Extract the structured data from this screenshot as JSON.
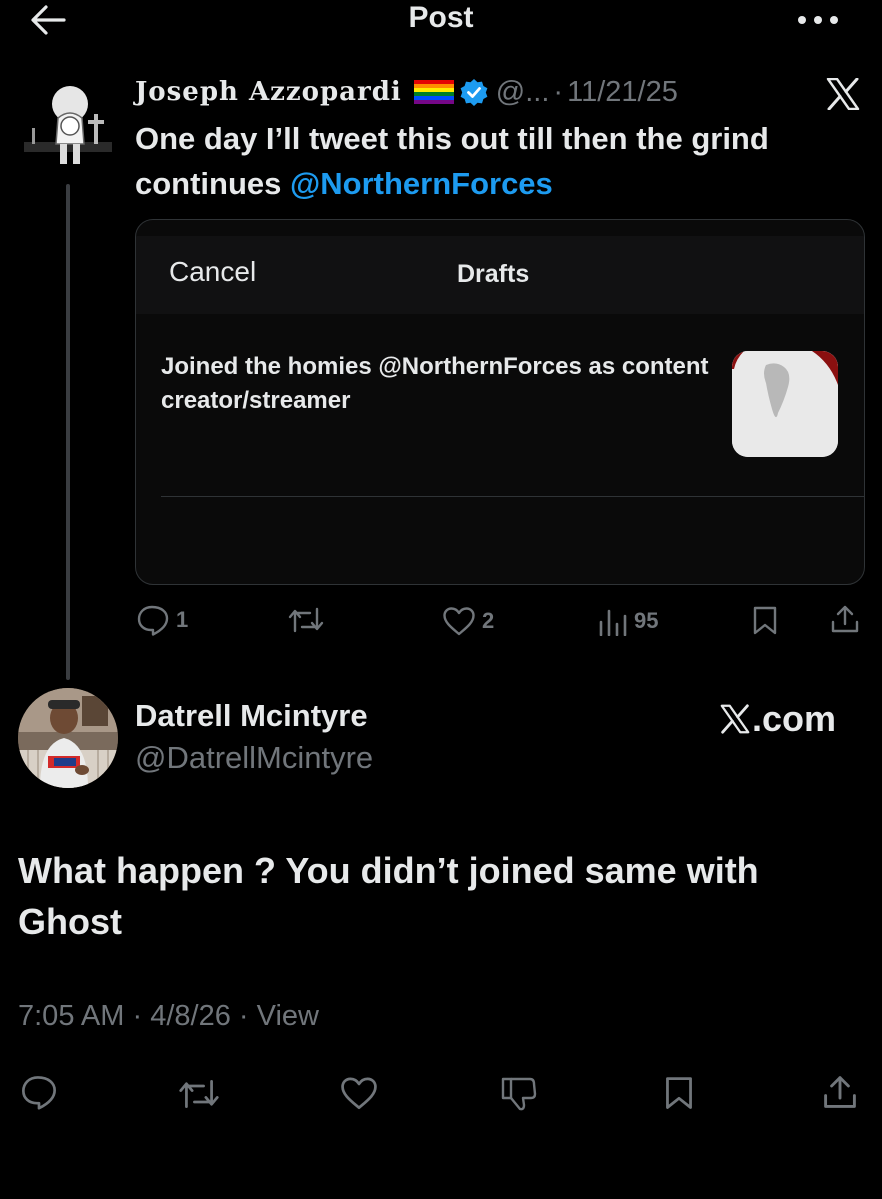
{
  "header": {
    "title": "Post",
    "back_icon": "arrow-left-icon",
    "more_icon": "more-horizontal-icon"
  },
  "quoted_post": {
    "name": "Joseph Azzopardi",
    "handle": "@...",
    "separator": "·",
    "date": "11/21/25",
    "text_plain": "One day  I’ll tweet this out till then the grind continues ",
    "mention": "@NorthernForces",
    "embedded_screenshot": {
      "cancel_label": "Cancel",
      "title": "Drafts",
      "draft_text": "Joined the homies @NorthernForces as content creator/streamer"
    },
    "stats": {
      "replies": "1",
      "likes": "2",
      "views": "95"
    }
  },
  "reply_post": {
    "name": "Datrell Mcintyre",
    "handle": "@DatrellMcintyre",
    "site_label": ".com",
    "text": "What happen ? You didn’t joined same with Ghost",
    "time": "7:05 AM",
    "separator": "·",
    "date": "4/8/26",
    "view_label": "View"
  },
  "colors": {
    "background": "#000000",
    "text": "#e7e9ea",
    "muted": "#71767b",
    "link": "#1d9bf0",
    "verified": "#1d9bf0",
    "border": "#2f3336"
  }
}
